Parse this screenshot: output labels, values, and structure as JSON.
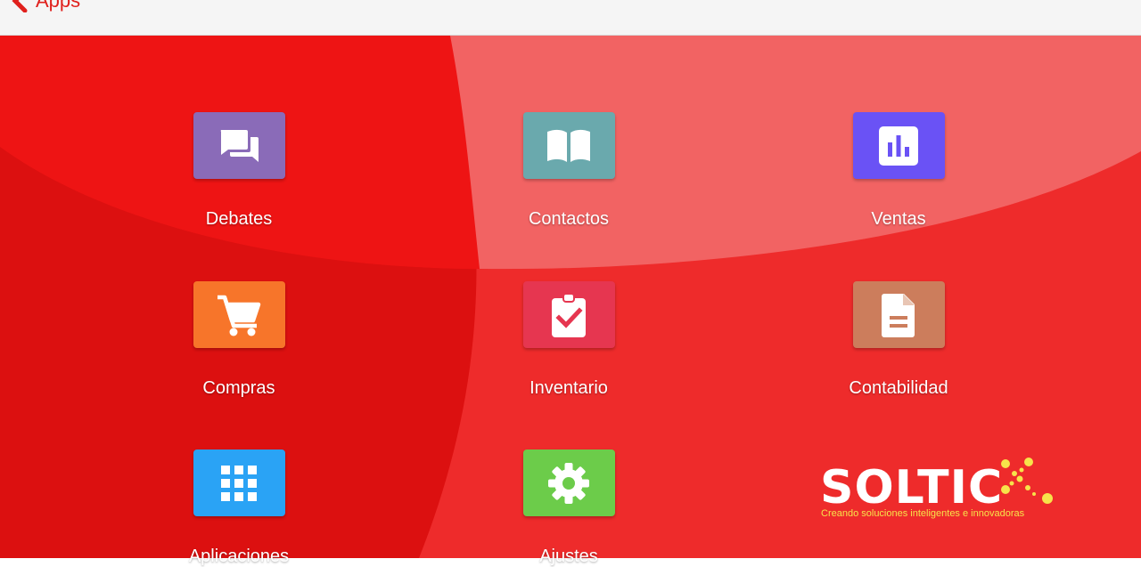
{
  "topbar": {
    "back_label": "Apps"
  },
  "colors": {
    "background": "#ee2b2b",
    "background_dark": "#dc1010",
    "background_light": "#f26363"
  },
  "apps": [
    {
      "name": "Debates",
      "icon": "chat-bubbles-icon",
      "color": "#8a6bb8"
    },
    {
      "name": "Contactos",
      "icon": "open-book-icon",
      "color": "#6aa9ad"
    },
    {
      "name": "Ventas",
      "icon": "bar-chart-icon",
      "color": "#6a52f5"
    },
    {
      "name": "Compras",
      "icon": "shopping-cart-icon",
      "color": "#f7752a"
    },
    {
      "name": "Inventario",
      "icon": "clipboard-check-icon",
      "color": "#e63650"
    },
    {
      "name": "Contabilidad",
      "icon": "document-icon",
      "color": "#cc7d5c"
    },
    {
      "name": "Aplicaciones",
      "icon": "grid-apps-icon",
      "color": "#2aa3f5"
    },
    {
      "name": "Ajustes",
      "icon": "gear-icon",
      "color": "#6ccc4a"
    }
  ],
  "logo": {
    "word": "SOLTIC",
    "tagline": "Creando soluciones inteligentes e innovadoras",
    "dot_color": "#f7e34a"
  }
}
